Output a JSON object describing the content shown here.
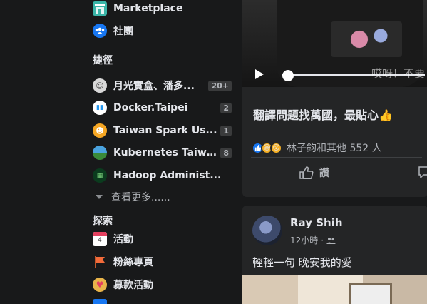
{
  "sidebar": {
    "top_items": [
      {
        "label": "Marketplace",
        "icon": "marketplace-icon"
      },
      {
        "label": "社團",
        "icon": "groups-icon"
      }
    ],
    "shortcuts_title": "捷徑",
    "shortcuts": [
      {
        "label": "月光實盒、潘多...",
        "badge": "20+"
      },
      {
        "label": "Docker.Taipei",
        "badge": "2"
      },
      {
        "label": "Taiwan Spark Us...",
        "badge": "1"
      },
      {
        "label": "Kubernetes Taiwa...",
        "badge": "8"
      },
      {
        "label": "Hadoop Administ...",
        "badge": ""
      }
    ],
    "see_more": "查看更多......",
    "explore_title": "探索",
    "explore": [
      {
        "label": "活動",
        "icon": "calendar-icon",
        "date": "4"
      },
      {
        "label": "粉絲專頁",
        "icon": "flag-icon"
      },
      {
        "label": "募款活動",
        "icon": "fundraiser-icon"
      }
    ]
  },
  "post1": {
    "video_subtitle": "哎呀！不要",
    "title": "翻譯問題找萬國，最貼心👍",
    "reactions_text": "林子鈞和其他 552 人",
    "like_label": "讚"
  },
  "post2": {
    "author": "Ray Shih",
    "time": "12小時",
    "separator": "·",
    "text": "輕輕一句 晚安我的愛"
  },
  "colors": {
    "background": "#18191a",
    "card": "#242526",
    "accent": "#1877f2"
  }
}
